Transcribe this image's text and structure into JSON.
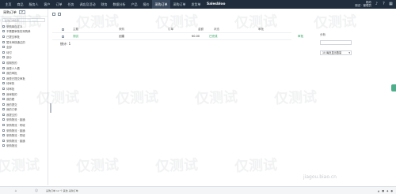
{
  "nav": {
    "items": [
      {
        "label": "主页"
      },
      {
        "label": "商品"
      },
      {
        "label": "服务人"
      },
      {
        "label": "客户"
      },
      {
        "label": "订单"
      },
      {
        "label": "任务"
      },
      {
        "label": "调店及活动"
      },
      {
        "label": "财务"
      },
      {
        "label": "数据分析"
      },
      {
        "label": "产品"
      },
      {
        "label": "报价"
      },
      {
        "label": "采购订单"
      },
      {
        "label": "采购订单"
      },
      {
        "label": "发货单"
      }
    ],
    "brand": "Salesbloo",
    "user_line1": "杨玲",
    "user_line2": "测试 · 管理员"
  },
  "sidebar": {
    "title": "采购订单",
    "search_placeholder": "采购订单名称",
    "items": [
      {
        "label": "采购单自定义",
        "sub": false
      },
      {
        "label": "不需要审核的采购单",
        "sub": false
      },
      {
        "label": "已提交审批",
        "sub": false
      },
      {
        "label": "暂未审核通过的",
        "sub": false
      },
      {
        "label": "全部",
        "sub": false
      },
      {
        "label": "待付",
        "sub": false
      },
      {
        "label": "部分",
        "sub": false
      },
      {
        "label": "前期的的",
        "sub": false
      },
      {
        "label": "我是人人看",
        "sub": false
      },
      {
        "label": "我的审批",
        "sub": false
      },
      {
        "label": "我是已提交审批",
        "sub": false
      },
      {
        "label": "待审的",
        "sub": false
      },
      {
        "label": "待审批",
        "sub": false
      },
      {
        "label": "我审核的",
        "sub": false
      },
      {
        "label": "我的看",
        "sub": false
      },
      {
        "label": "我的提交",
        "sub": false
      },
      {
        "label": "我的订单",
        "sub": false
      },
      {
        "label": "我提交的",
        "sub": false
      },
      {
        "label": "采购物流 · 普通",
        "sub": false
      },
      {
        "label": "采购物流 · 同城",
        "sub": false
      },
      {
        "label": "采购物流 · 普通",
        "sub": false
      },
      {
        "label": "采购物流 · 同城",
        "sub": false
      },
      {
        "label": "采购物流 · 普通",
        "sub": false
      },
      {
        "label": "采购物流",
        "sub": false
      }
    ]
  },
  "table": {
    "headers": [
      "主题",
      "采购",
      "订单",
      "金额",
      "状态",
      "审批"
    ],
    "rows": [
      {
        "subject": "测试",
        "type": "创建",
        "amount": "¥0.00",
        "status": "已完成",
        "approve": "审批"
      }
    ],
    "total_label": "统计: 1"
  },
  "panel": {
    "title": "分析",
    "select_value": "10 每页显示数量",
    "select_arrow": "▾"
  },
  "bottom": {
    "left_text": "采购订单 12 个 其他 采购订单",
    "right_items": [
      "▲",
      "■",
      "◆",
      "●"
    ]
  },
  "watermark": {
    "text": "仅测试",
    "url": "jiagou.biao.cn"
  },
  "colors": {
    "topbar": "#1f2d3d",
    "accent": "#2a9d5c"
  }
}
